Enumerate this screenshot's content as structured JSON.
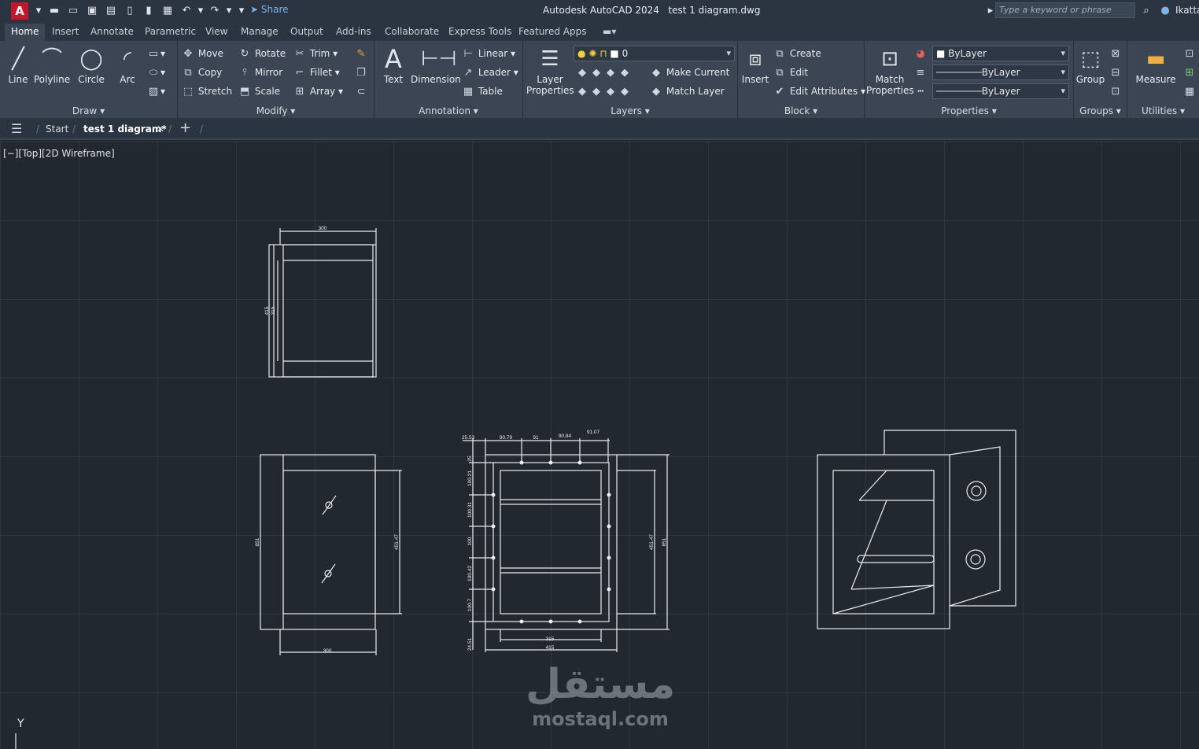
{
  "app": {
    "logo": "A",
    "share_label": "Share",
    "product": "Autodesk AutoCAD 2024",
    "filename": "test 1 diagram.dwg",
    "search_placeholder": "Type a keyword or phrase",
    "user": "Ikatta"
  },
  "ribbon_tabs": [
    "Home",
    "Insert",
    "Annotate",
    "Parametric",
    "View",
    "Manage",
    "Output",
    "Add-ins",
    "Collaborate",
    "Express Tools",
    "Featured Apps"
  ],
  "draw": {
    "label": "Draw",
    "line": "Line",
    "polyline": "Polyline",
    "circle": "Circle",
    "arc": "Arc"
  },
  "modify": {
    "label": "Modify",
    "move": "Move",
    "rotate": "Rotate",
    "trim": "Trim",
    "copy": "Copy",
    "mirror": "Mirror",
    "fillet": "Fillet",
    "stretch": "Stretch",
    "scale": "Scale",
    "array": "Array"
  },
  "annotation": {
    "label": "Annotation",
    "text": "Text",
    "dimension": "Dimension",
    "linear": "Linear",
    "leader": "Leader",
    "table": "Table"
  },
  "layers": {
    "label": "Layers",
    "properties_l1": "Layer",
    "properties_l2": "Properties",
    "current_layer": "0",
    "make_current": "Make Current",
    "match_layer": "Match Layer"
  },
  "block": {
    "label": "Block",
    "insert": "Insert",
    "create": "Create",
    "edit": "Edit",
    "edit_attributes": "Edit Attributes"
  },
  "properties": {
    "label": "Properties",
    "match_l1": "Match",
    "match_l2": "Properties",
    "color": "ByLayer",
    "linetype": "ByLayer",
    "lineweight": "ByLayer"
  },
  "groups": {
    "label": "Groups",
    "group": "Group"
  },
  "utilities": {
    "label": "Utilities",
    "measure": "Measure"
  },
  "doc_tabs": {
    "start": "Start",
    "active": "test 1 diagram*"
  },
  "viewport_label": "[−][Top][2D Wireframe]",
  "dims": {
    "top_width": "300",
    "top_h1": "415",
    "top_h2": "315",
    "front_height": "851",
    "front_inner": "451.47",
    "front_width": "300",
    "top_row": [
      "25.53",
      "90.79",
      "91",
      "90.84",
      "91.07"
    ],
    "side_col": [
      "25",
      "100.21",
      "100.31",
      "100",
      "100.42",
      "100.7",
      "24.51"
    ],
    "mid_right_inner": "451.47",
    "mid_right_outer": "851",
    "bottom_inner": "315",
    "bottom_outer": "415"
  },
  "watermark": {
    "arabic": "مستقل",
    "latin": "mostaql.com"
  },
  "ucs_label": "Y"
}
